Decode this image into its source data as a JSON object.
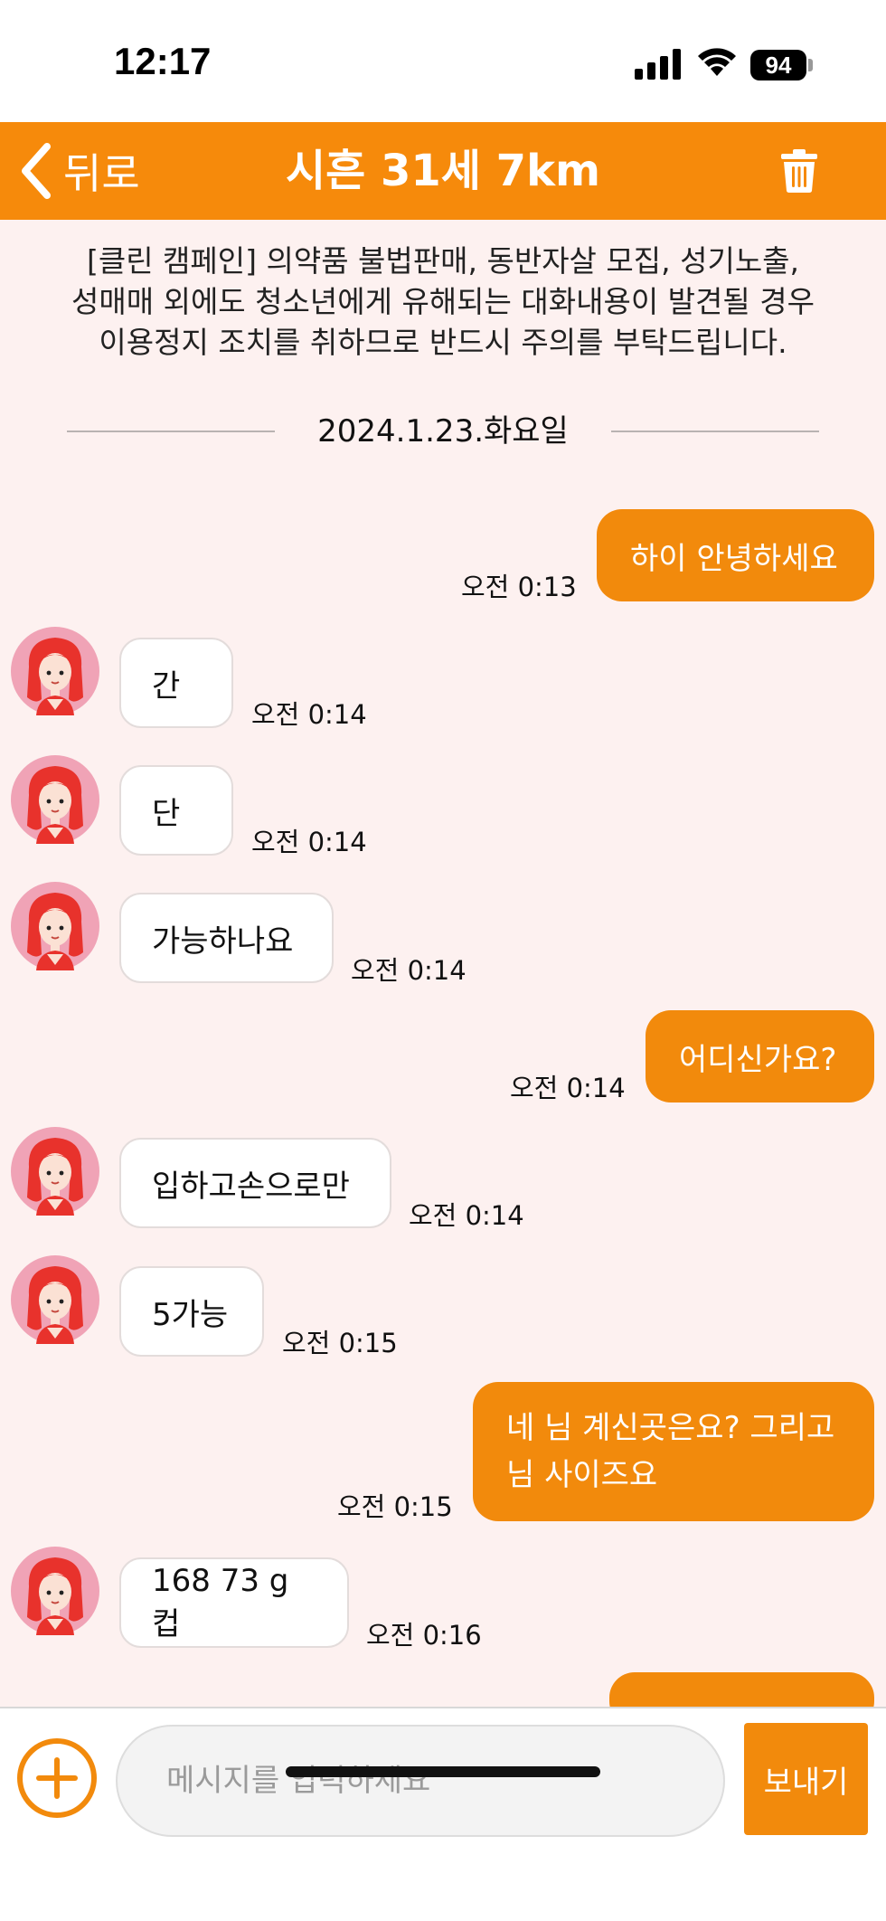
{
  "status_bar": {
    "time": "12:17",
    "battery": "94"
  },
  "header": {
    "back_label": "뒤로",
    "title": "시흔 31세 7km"
  },
  "notice": {
    "lines": [
      "[클린 캠페인] 의약품 불법판매, 동반자살 모집, 성기노출,",
      "성매매 외에도 청소년에게 유해되는 대화내용이 발견될 경우",
      "이용정지 조치를 취하므로 반드시 주의를 부탁드립니다."
    ]
  },
  "date_label": "2024.1.23.화요일",
  "messages": [
    {
      "dir": "out",
      "lines": [
        "하이 안녕하세요"
      ],
      "time": "오전 0:13"
    },
    {
      "dir": "in",
      "lines": [
        "간"
      ],
      "time": "오전 0:14"
    },
    {
      "dir": "in",
      "lines": [
        "단"
      ],
      "time": "오전 0:14"
    },
    {
      "dir": "in",
      "lines": [
        "가능하나요"
      ],
      "time": "오전 0:14"
    },
    {
      "dir": "out",
      "lines": [
        "어디신가요?"
      ],
      "time": "오전 0:14"
    },
    {
      "dir": "in",
      "lines": [
        "입하고손으로만"
      ],
      "time": "오전 0:14"
    },
    {
      "dir": "in",
      "lines": [
        "5가능"
      ],
      "time": "오전 0:15"
    },
    {
      "dir": "out",
      "lines": [
        "네 님 계신곳은요? 그리고",
        "님 사이즈요"
      ],
      "time": "오전 0:15"
    },
    {
      "dir": "in",
      "lines": [
        "168 73 g컵"
      ],
      "time": "오전 0:16"
    }
  ],
  "input": {
    "placeholder": "메시지를 입력하세요"
  },
  "send_label": "보내기",
  "colors": {
    "accent": "#f68a0b",
    "background": "#fdf1f0",
    "bubble_in": "#ffffff"
  },
  "icons": {
    "back": "chevron-left-icon",
    "trash": "trash-icon",
    "plus": "plus-circle-icon",
    "avatar": "red-hair-girl-avatar"
  }
}
